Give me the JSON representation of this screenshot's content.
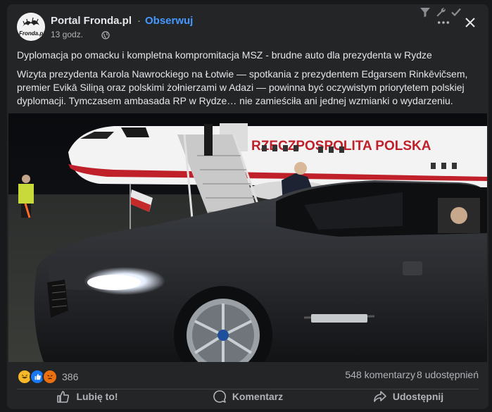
{
  "post": {
    "page_name": "Portal Fronda.pl",
    "separator": "·",
    "follow_label": "Obserwuj",
    "timestamp": "13 godz.",
    "avatar_text": "Fronda.pl",
    "headline": "Dyplomacja po omacku i kompletna kompromitacja MSZ - brudne auto dla prezydenta w Rydze",
    "body": "Wizyta prezydenta Karola Nawrockiego na Łotwie — spotkania z prezydentem Edgarsem Rinkēvičsem, premier Evikā Siliņą oraz polskimi żołnierzami w Adazi — powinna być oczywistym priorytetem polskiej dyplomacji. Tymczasem ambasada RP w Rydze… nie zamieściła ani jednej wzmianki o wydarzeniu.",
    "photo_plane_text": "RZECZPOSPOLITA POLSKA"
  },
  "stats": {
    "reaction_count": "386",
    "comments": "548 komentarzy",
    "shares": "8 udostępnień",
    "reactions": [
      "haha",
      "like",
      "angry"
    ]
  },
  "actions": {
    "like": "Lubię to!",
    "comment": "Komentarz",
    "share": "Udostępnij"
  },
  "icons": {
    "topbar": [
      "filter-icon",
      "wrench-icon",
      "check-icon"
    ],
    "more": "more-dots-icon",
    "close": "close-icon",
    "privacy": "globe-icon"
  },
  "colors": {
    "card_bg": "#242526",
    "accent": "#4599ff",
    "text": "#e4e6eb",
    "secondary_text": "#b0b3b8"
  }
}
